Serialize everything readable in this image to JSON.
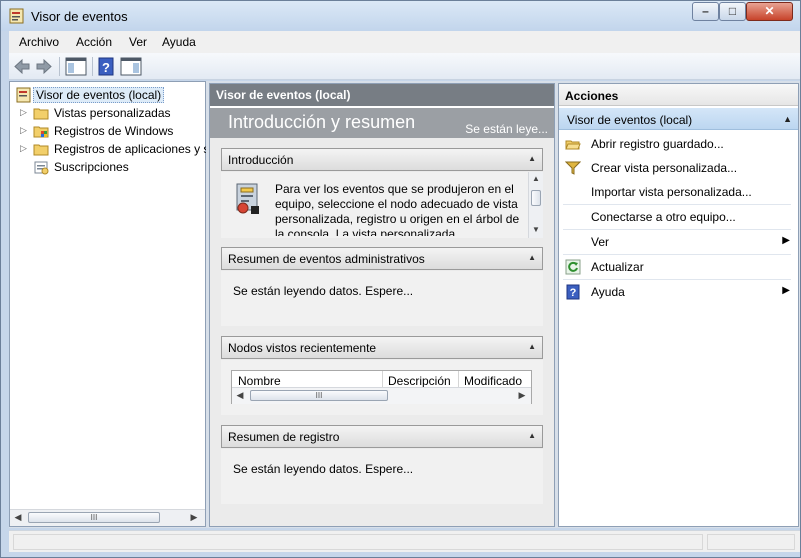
{
  "window": {
    "title": "Visor de eventos",
    "minimize_glyph": "–",
    "maximize_glyph": "□",
    "close_glyph": "✕"
  },
  "menu": {
    "items": [
      "Archivo",
      "Acción",
      "Ver",
      "Ayuda"
    ]
  },
  "toolbar": {
    "icons": [
      "back-icon",
      "forward-icon",
      "console-tree-icon",
      "help-icon",
      "action-pane-icon"
    ]
  },
  "tree": {
    "items": [
      {
        "label": "Visor de eventos (local)",
        "icon": "event-viewer-icon",
        "expandable": false,
        "selected": true
      },
      {
        "label": "Vistas personalizadas",
        "icon": "folder-icon",
        "expandable": true
      },
      {
        "label": "Registros de Windows",
        "icon": "windows-logs-icon",
        "expandable": true
      },
      {
        "label": "Registros de aplicaciones y s",
        "icon": "folder-icon",
        "expandable": true
      },
      {
        "label": "Suscripciones",
        "icon": "subscriptions-icon",
        "expandable": false
      }
    ],
    "scroll_thumb_glyph": "III"
  },
  "center": {
    "header": "Visor de eventos (local)",
    "banner_title": "Introducción y resumen",
    "banner_status": "Se están leye...",
    "sections": {
      "intro": {
        "title": "Introducción",
        "text": "Para ver los eventos que se produjeron en el equipo, seleccione el nodo adecuado de vista personalizada, registro u origen en el árbol de la consola. La vista personalizada"
      },
      "admin_summary": {
        "title": "Resumen de eventos administrativos",
        "text": "Se están leyendo datos. Espere..."
      },
      "recent_nodes": {
        "title": "Nodos vistos recientemente",
        "columns": [
          "Nombre",
          "Descripción",
          "Modificado"
        ],
        "scroll_thumb_glyph": "III"
      },
      "log_summary": {
        "title": "Resumen de registro",
        "text": "Se están leyendo datos. Espere..."
      }
    }
  },
  "actions": {
    "title": "Acciones",
    "group": "Visor de eventos (local)",
    "items": [
      {
        "label": "Abrir registro guardado...",
        "icon": "open-folder-icon",
        "submenu": false
      },
      {
        "label": "Crear vista personalizada...",
        "icon": "filter-icon",
        "submenu": false
      },
      {
        "label": "Importar vista personalizada...",
        "icon": "",
        "submenu": false
      },
      {
        "label": "Conectarse a otro equipo...",
        "icon": "",
        "submenu": false
      },
      {
        "label": "Ver",
        "icon": "",
        "submenu": true
      },
      {
        "label": "Actualizar",
        "icon": "refresh-icon",
        "submenu": false
      },
      {
        "label": "Ayuda",
        "icon": "help-icon",
        "submenu": true
      }
    ]
  },
  "colors": {
    "title_bar": "#c2d5ec",
    "center_header": "#777d84",
    "actions_group": "#bcd6f0"
  }
}
